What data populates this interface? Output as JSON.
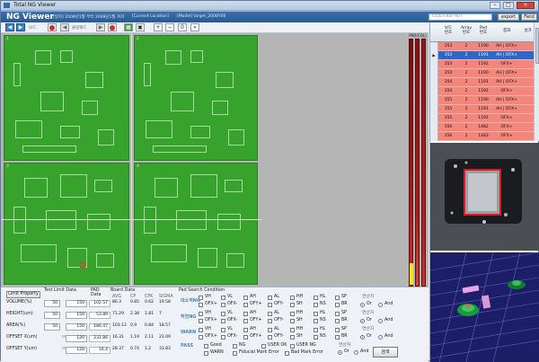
{
  "window": {
    "title": "Total NG Viewer"
  },
  "header": {
    "app_title": "NG Viewer",
    "period": "[일자] 2008년1월 부터 2008년1월 까지",
    "location": "[Current Location]",
    "target": "[Model] target_2008Y00",
    "filter_placeholder": "Click Filter 제거",
    "export_label": "export",
    "field_label": "Field"
  },
  "toolbar": {
    "label1": "보드",
    "label2": "불량패드",
    "zoom_value": "0"
  },
  "boards": [
    {
      "label": "1"
    },
    {
      "label": "2"
    },
    {
      "label": "3"
    },
    {
      "label": "4"
    }
  ],
  "scale": {
    "label": "PAD(COL)"
  },
  "grid": {
    "headers": [
      "보드\n번호",
      "Array\n번호",
      "Pad\n번호",
      "결과",
      "성가"
    ],
    "rows": [
      {
        "board": "353",
        "array": "2",
        "pad": "1190",
        "result": "AH | OFX+"
      },
      {
        "board": "353",
        "array": "2",
        "pad": "1191",
        "result": "AH | OFX+"
      },
      {
        "board": "353",
        "array": "2",
        "pad": "1192",
        "result": "OFX+"
      },
      {
        "board": "354",
        "array": "2",
        "pad": "1190",
        "result": "AH | OFX+"
      },
      {
        "board": "354",
        "array": "2",
        "pad": "1191",
        "result": "AH | OFX+"
      },
      {
        "board": "354",
        "array": "2",
        "pad": "1192",
        "result": "OFX+"
      },
      {
        "board": "355",
        "array": "2",
        "pad": "1190",
        "result": "AH | OFX+"
      },
      {
        "board": "355",
        "array": "2",
        "pad": "1191",
        "result": "AH | OFX+"
      },
      {
        "board": "355",
        "array": "2",
        "pad": "1192",
        "result": "OFX+"
      },
      {
        "board": "356",
        "array": "2",
        "pad": "1482",
        "result": "OFX+"
      },
      {
        "board": "356",
        "array": "2",
        "pad": "1483",
        "result": "OFX+"
      }
    ]
  },
  "bottom": {
    "limit_button": "Limit Property",
    "col_headers": {
      "test_limit": "Test Limit Data",
      "pad_data": "PAD\nData",
      "board_data": "Board Data",
      "pad_search": "Pad Search Condition"
    },
    "board_sub": [
      "AVG",
      "CP",
      "CPK",
      "SIGMA"
    ],
    "rows": [
      {
        "name": "VOLUME(%)",
        "lower": "50",
        "upper": "150",
        "pad": "102.57",
        "avg": "86.3",
        "cp": "0.85",
        "cpk": "0.62",
        "sigma": "19.58"
      },
      {
        "name": "HEIGHT(um)",
        "lower": "50",
        "upper": "150",
        "pad": "53.89",
        "avg": "71.29",
        "cp": "2.38",
        "cpk": "1.81",
        "sigma": "7"
      },
      {
        "name": "AREA(%)",
        "lower": "50",
        "upper": "150",
        "pad": "186.47",
        "avg": "103.13",
        "cp": "0.9",
        "cpk": "0.84",
        "sigma": "18.57"
      },
      {
        "name": "OFFSET X(um)",
        "lower": "",
        "upper": "120",
        "pad": "231.86",
        "avg": "16.31",
        "cp": "1.19",
        "cpk": "2.11",
        "sigma": "21.09"
      },
      {
        "name": "OFFSET Y(um)",
        "lower": "",
        "upper": "120",
        "pad": "16.4",
        "avg": "28.37",
        "cp": "0.74",
        "cpk": "1.2",
        "sigma": "33.83"
      }
    ],
    "over_label": "over",
    "categories": [
      {
        "name": "대소적NG",
        "row1": [
          "VH",
          "VL",
          "AH",
          "AL",
          "HH",
          "HL",
          "SP"
        ],
        "row2": [
          "OFX+",
          "OFX-",
          "OFY+",
          "OFY-",
          "SH",
          "NS",
          "BR"
        ]
      },
      {
        "name": "허연NG",
        "row1": [
          "VH",
          "VL",
          "AH",
          "AL",
          "HH",
          "HL",
          "SP"
        ],
        "row2": [
          "OFX+",
          "OFX-",
          "OFY+",
          "OFY-",
          "SH",
          "NS",
          "BR"
        ]
      },
      {
        "name": "WARN",
        "row1": [
          "VH",
          "VL",
          "AH",
          "AL",
          "HH",
          "HL",
          "SP"
        ],
        "row2": [
          "OFX+",
          "OFX-",
          "OFY+",
          "OFY-",
          "SH",
          "NS",
          "BR"
        ]
      }
    ],
    "pass": {
      "name": "PASS",
      "items": [
        "Good",
        "NG",
        "USER OK",
        "USER NG",
        "WARN",
        "Fiducial Mark Error",
        "Bad Mark Error"
      ]
    },
    "logic": {
      "label": "연산자",
      "or": "Or",
      "and": "And"
    },
    "search_button": "검색"
  },
  "colors": {
    "board": "#37a32d",
    "ng_row": "#f4857b",
    "selected_row": "#2e67c9",
    "header": "#2a5a94"
  }
}
